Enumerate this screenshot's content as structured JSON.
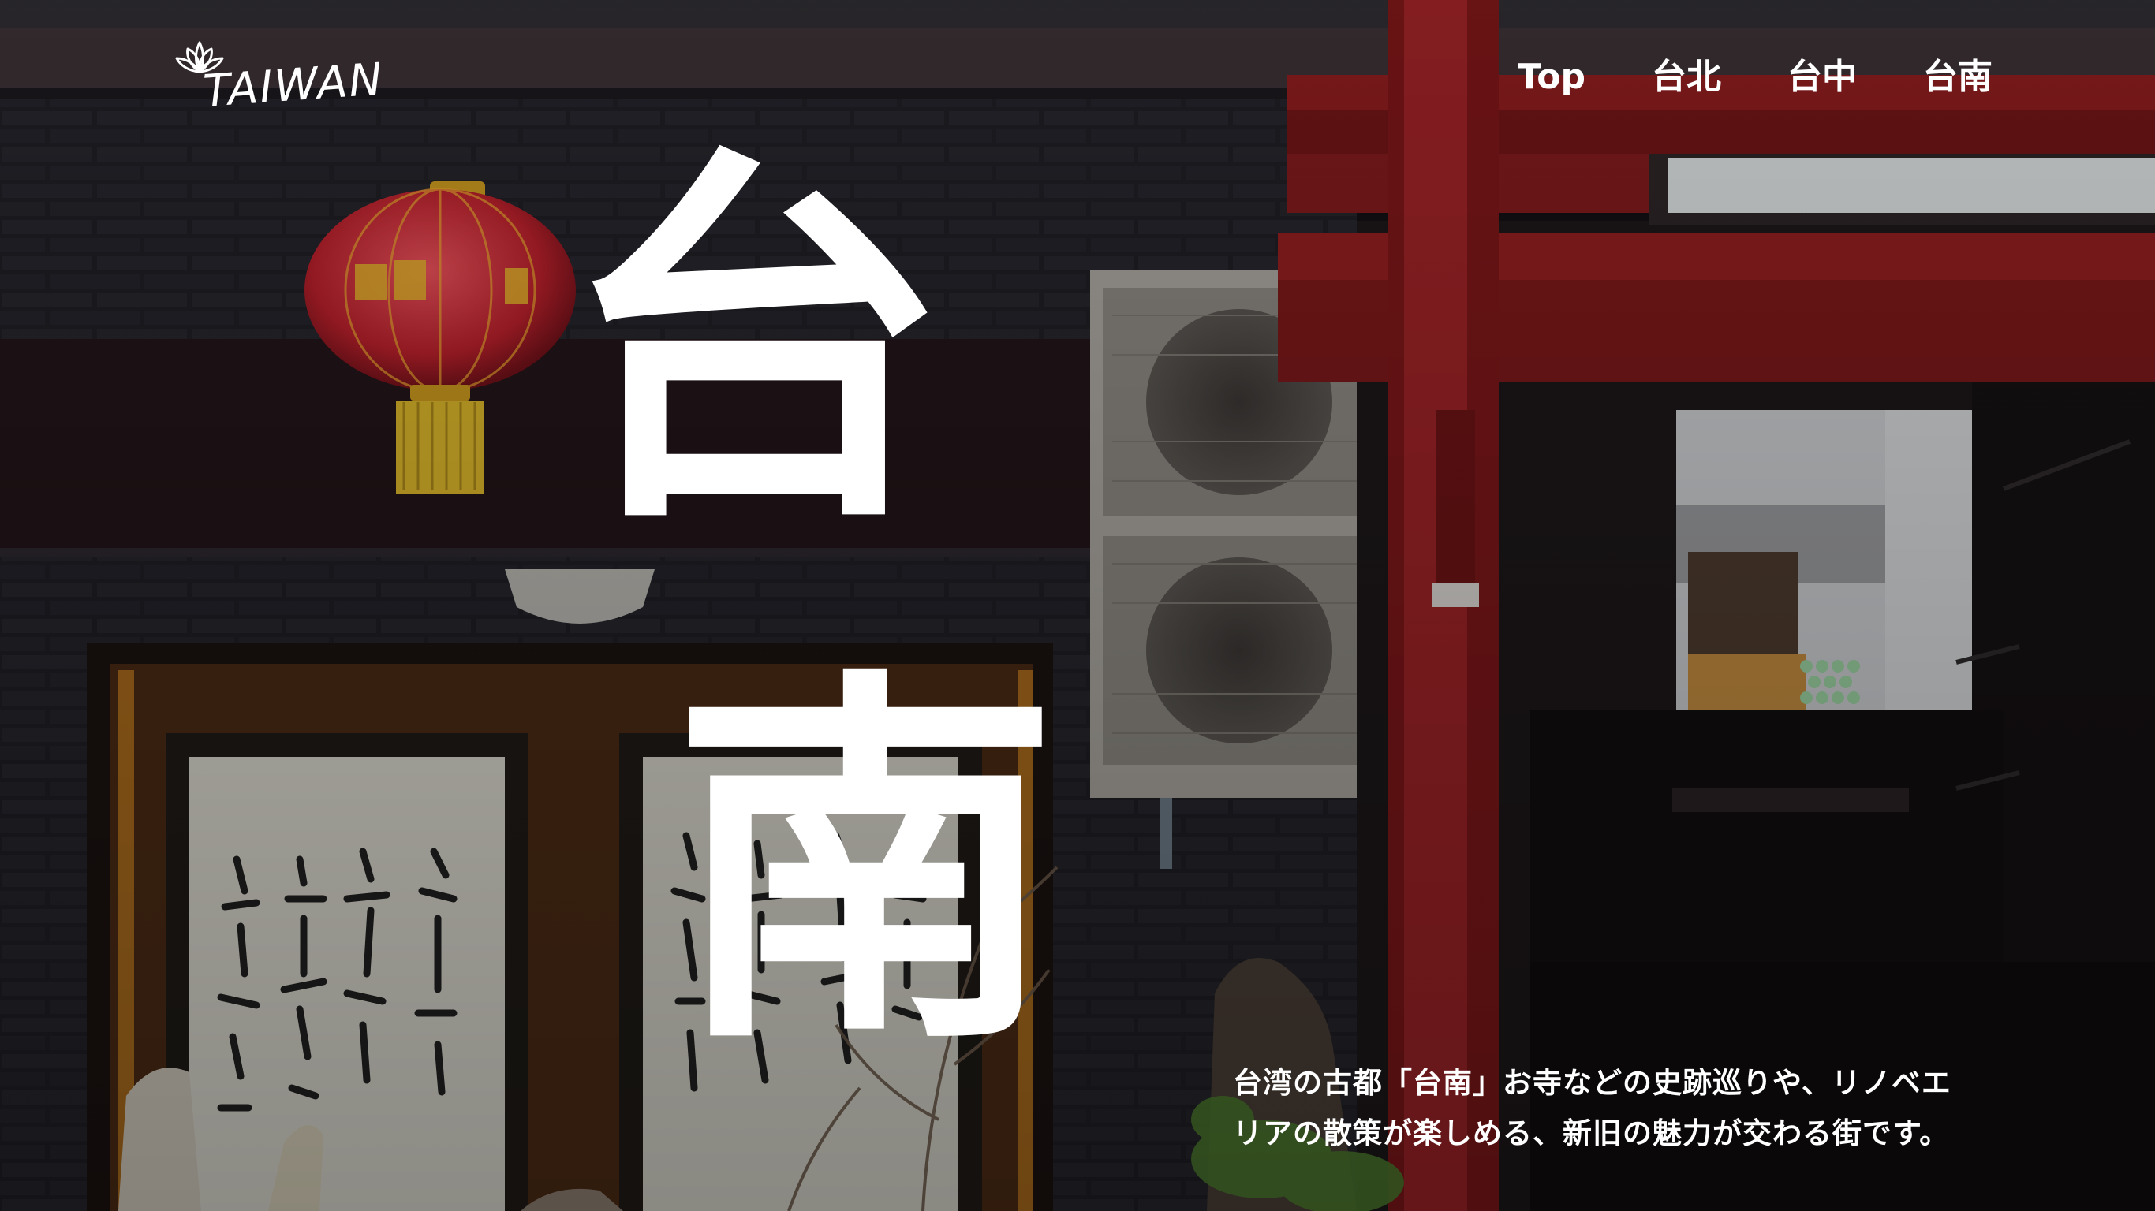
{
  "logo": {
    "text": "TAIWAN",
    "icon": "lotus-icon"
  },
  "nav": {
    "items": [
      {
        "label": "Top"
      },
      {
        "label": "台北"
      },
      {
        "label": "台中"
      },
      {
        "label": "台南"
      }
    ]
  },
  "hero": {
    "title_char_1": "台",
    "title_char_2": "南",
    "description_line_1": "台湾の古都「台南」お寺などの史跡巡りや、リノベエ",
    "description_line_2": "リアの散策が楽しめる、新旧の魅力が交わる街です。",
    "background": "temple-street-photo"
  },
  "colors": {
    "text": "#ffffff",
    "wall": "#1c1a20",
    "pillar_red": "#8e1e20",
    "lantern_red": "#c8262c",
    "lantern_gold": "#d4a21e"
  }
}
